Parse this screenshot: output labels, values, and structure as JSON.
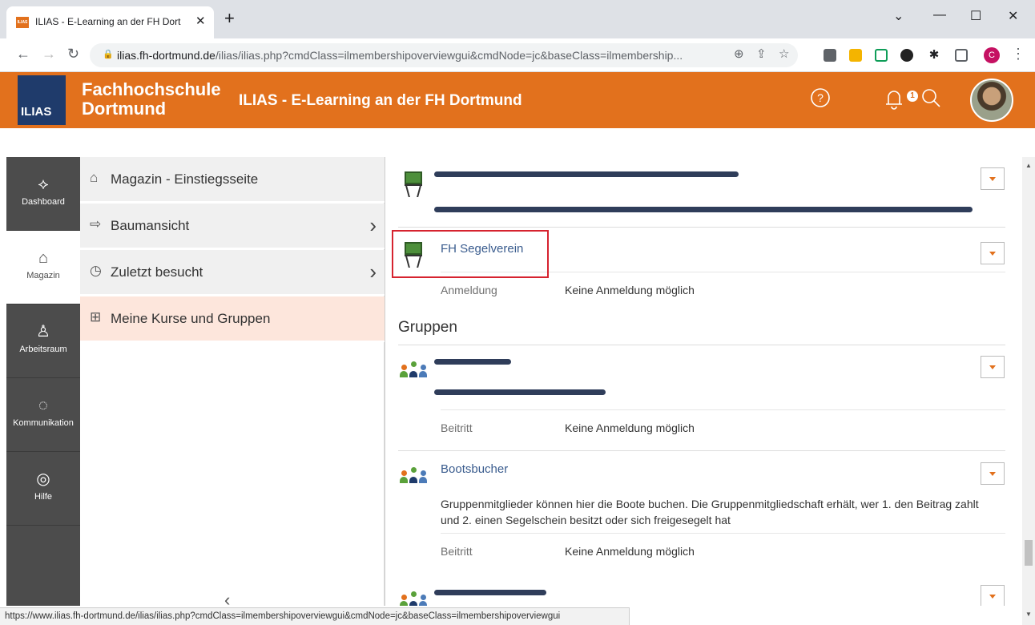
{
  "browser": {
    "tab_title": "ILIAS - E-Learning an der FH Dort",
    "tab_favicon": "ILIAS",
    "new_tab": "+",
    "url_host": "ilias.fh-dortmund.de",
    "url_path": "/ilias/ilias.php?cmdClass=ilmembershipoverviewgui&cmdNode=jc&baseClass=ilmembership...",
    "profile_initial": "C",
    "status_url": "https://www.ilias.fh-dortmund.de/ilias/ilias.php?cmdClass=ilmembershipoverviewgui&cmdNode=jc&baseClass=ilmembershipoverviewgui"
  },
  "header": {
    "logo_text": "ILIAS",
    "institution_line1": "Fachhochschule",
    "institution_line2": "Dortmund",
    "title": "ILIAS - E-Learning an der FH Dortmund",
    "notification_count": "1",
    "accent_color": "#e2711d"
  },
  "mainbar": {
    "items": [
      {
        "label": "Dashboard"
      },
      {
        "label": "Magazin"
      },
      {
        "label": "Arbeitsraum"
      },
      {
        "label": "Kommunikation"
      },
      {
        "label": "Hilfe"
      }
    ]
  },
  "slate": {
    "items": [
      {
        "label": "Magazin - Einstiegsseite"
      },
      {
        "label": "Baumansicht"
      },
      {
        "label": "Zuletzt besucht"
      },
      {
        "label": "Meine Kurse und Gruppen"
      }
    ]
  },
  "content": {
    "course_segelverein": {
      "title": "FH Segelverein",
      "prop_label": "Anmeldung",
      "prop_value": "Keine Anmeldung möglich"
    },
    "groups_heading": "Gruppen",
    "group_1": {
      "prop_label": "Beitritt",
      "prop_value": "Keine Anmeldung möglich"
    },
    "group_bootsbucher": {
      "title": "Bootsbucher",
      "description": "Gruppenmitglieder können hier die Boote buchen. Die Gruppenmitgliedschaft erhält, wer 1. den Beitrag zahlt und 2. einen Segelschein besitzt oder sich freigesegelt hat",
      "prop_label": "Beitritt",
      "prop_value": "Keine Anmeldung möglich"
    }
  }
}
